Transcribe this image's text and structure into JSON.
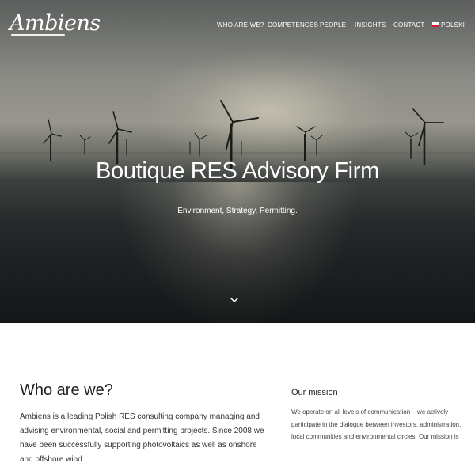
{
  "header": {
    "logo": "Ambiens",
    "nav": [
      {
        "label": "WHO ARE WE?"
      },
      {
        "label": "COMPETENCES"
      },
      {
        "label": "PEOPLE"
      },
      {
        "label": "INSIGHTS"
      },
      {
        "label": "CONTACT"
      },
      {
        "label": "POLSKI"
      }
    ]
  },
  "hero": {
    "title": "Boutique RES Advisory Firm",
    "subtitle": "Environment, Strategy, Permitting."
  },
  "who": {
    "title": "Who are we?",
    "text": "Ambiens is a leading Polish RES consulting company managing and advising environmental, social and permitting projects. Since 2008 we have been successfully supporting photovoltaics as well as onshore and offshore wind"
  },
  "mission": {
    "title": "Our mission",
    "text": "We operate on all levels of communication – we actively participate in the dialogue between investors, administration, local communities and environmental circles. Our mission is"
  },
  "colors": {
    "text_dark": "#222222",
    "flag_red": "#dc143c"
  }
}
